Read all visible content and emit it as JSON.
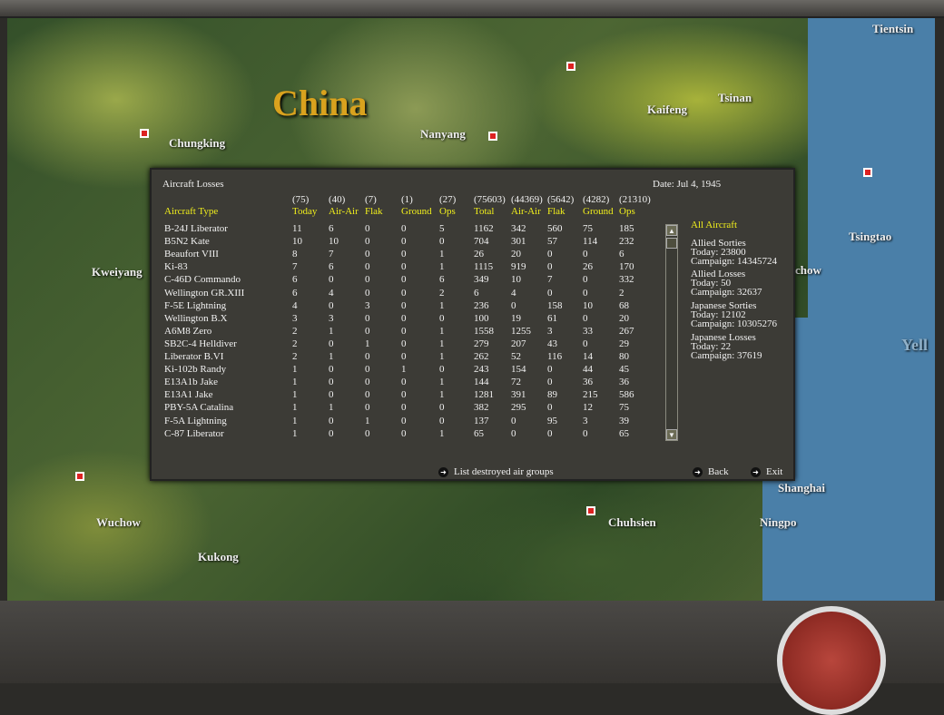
{
  "map": {
    "title": "China",
    "cities": [
      "Chungking",
      "Nanyang",
      "Kaifeng",
      "Tsinan",
      "Tientsin",
      "Tsingtao",
      "Kweiyang",
      "chow",
      "Yell",
      "Wuchow",
      "Kukong",
      "Chuhsien",
      "Ningpo",
      "Shanghai"
    ]
  },
  "dialog": {
    "title": "Aircraft Losses",
    "date": "Date: Jul 4, 1945",
    "type_header": "Aircraft Type",
    "headers": [
      "Today",
      "Air-Air",
      "Flak",
      "Ground",
      "Ops",
      "Total",
      "Air-Air",
      "Flak",
      "Ground",
      "Ops"
    ],
    "totals": [
      "(75)",
      "(40)",
      "(7)",
      "(1)",
      "(27)",
      "(75603)",
      "(44369)",
      "(5642)",
      "(4282)",
      "(21310)"
    ],
    "rows": [
      [
        "B-24J Liberator",
        "11",
        "6",
        "0",
        "0",
        "5",
        "1162",
        "342",
        "560",
        "75",
        "185"
      ],
      [
        "B5N2 Kate",
        "10",
        "10",
        "0",
        "0",
        "0",
        "704",
        "301",
        "57",
        "114",
        "232"
      ],
      [
        "Beaufort VIII",
        "8",
        "7",
        "0",
        "0",
        "1",
        "26",
        "20",
        "0",
        "0",
        "6"
      ],
      [
        "Ki-83",
        "7",
        "6",
        "0",
        "0",
        "1",
        "1115",
        "919",
        "0",
        "26",
        "170"
      ],
      [
        "C-46D Commando",
        "6",
        "0",
        "0",
        "0",
        "6",
        "349",
        "10",
        "7",
        "0",
        "332"
      ],
      [
        "Wellington GR.XIII",
        "6",
        "4",
        "0",
        "0",
        "2",
        "6",
        "4",
        "0",
        "0",
        "2"
      ],
      [
        "F-5E Lightning",
        "4",
        "0",
        "3",
        "0",
        "1",
        "236",
        "0",
        "158",
        "10",
        "68"
      ],
      [
        "Wellington B.X",
        "3",
        "3",
        "0",
        "0",
        "0",
        "100",
        "19",
        "61",
        "0",
        "20"
      ],
      [
        "A6M8 Zero",
        "2",
        "1",
        "0",
        "0",
        "1",
        "1558",
        "1255",
        "3",
        "33",
        "267"
      ],
      [
        "SB2C-4 Helldiver",
        "2",
        "0",
        "1",
        "0",
        "1",
        "279",
        "207",
        "43",
        "0",
        "29"
      ],
      [
        "Liberator B.VI",
        "2",
        "1",
        "0",
        "0",
        "1",
        "262",
        "52",
        "116",
        "14",
        "80"
      ],
      [
        "Ki-102b Randy",
        "1",
        "0",
        "0",
        "1",
        "0",
        "243",
        "154",
        "0",
        "44",
        "45"
      ],
      [
        "E13A1b Jake",
        "1",
        "0",
        "0",
        "0",
        "1",
        "144",
        "72",
        "0",
        "36",
        "36"
      ],
      [
        "E13A1 Jake",
        "1",
        "0",
        "0",
        "0",
        "1",
        "1281",
        "391",
        "89",
        "215",
        "586"
      ],
      [
        "PBY-5A Catalina",
        "1",
        "1",
        "0",
        "0",
        "0",
        "382",
        "295",
        "0",
        "12",
        "75"
      ],
      [
        "F-5A Lightning",
        "1",
        "0",
        "1",
        "0",
        "0",
        "137",
        "0",
        "95",
        "3",
        "39"
      ],
      [
        "C-87 Liberator",
        "1",
        "0",
        "0",
        "0",
        "1",
        "65",
        "0",
        "0",
        "0",
        "65"
      ]
    ],
    "summary": {
      "filter": "All Aircraft",
      "allied_sorties": {
        "label": "Allied Sorties",
        "today": "Today:   23800",
        "campaign": "Campaign: 14345724"
      },
      "allied_losses": {
        "label": "Allied Losses",
        "today": "Today:   50",
        "campaign": "Campaign: 32637"
      },
      "japanese_sorties": {
        "label": "Japanese Sorties",
        "today": "Today:   12102",
        "campaign": "Campaign: 10305276"
      },
      "japanese_losses": {
        "label": "Japanese Losses",
        "today": "Today:   22",
        "campaign": "Campaign: 37619"
      }
    },
    "buttons": {
      "list": "List destroyed air groups",
      "back": "Back",
      "exit": "Exit"
    }
  }
}
